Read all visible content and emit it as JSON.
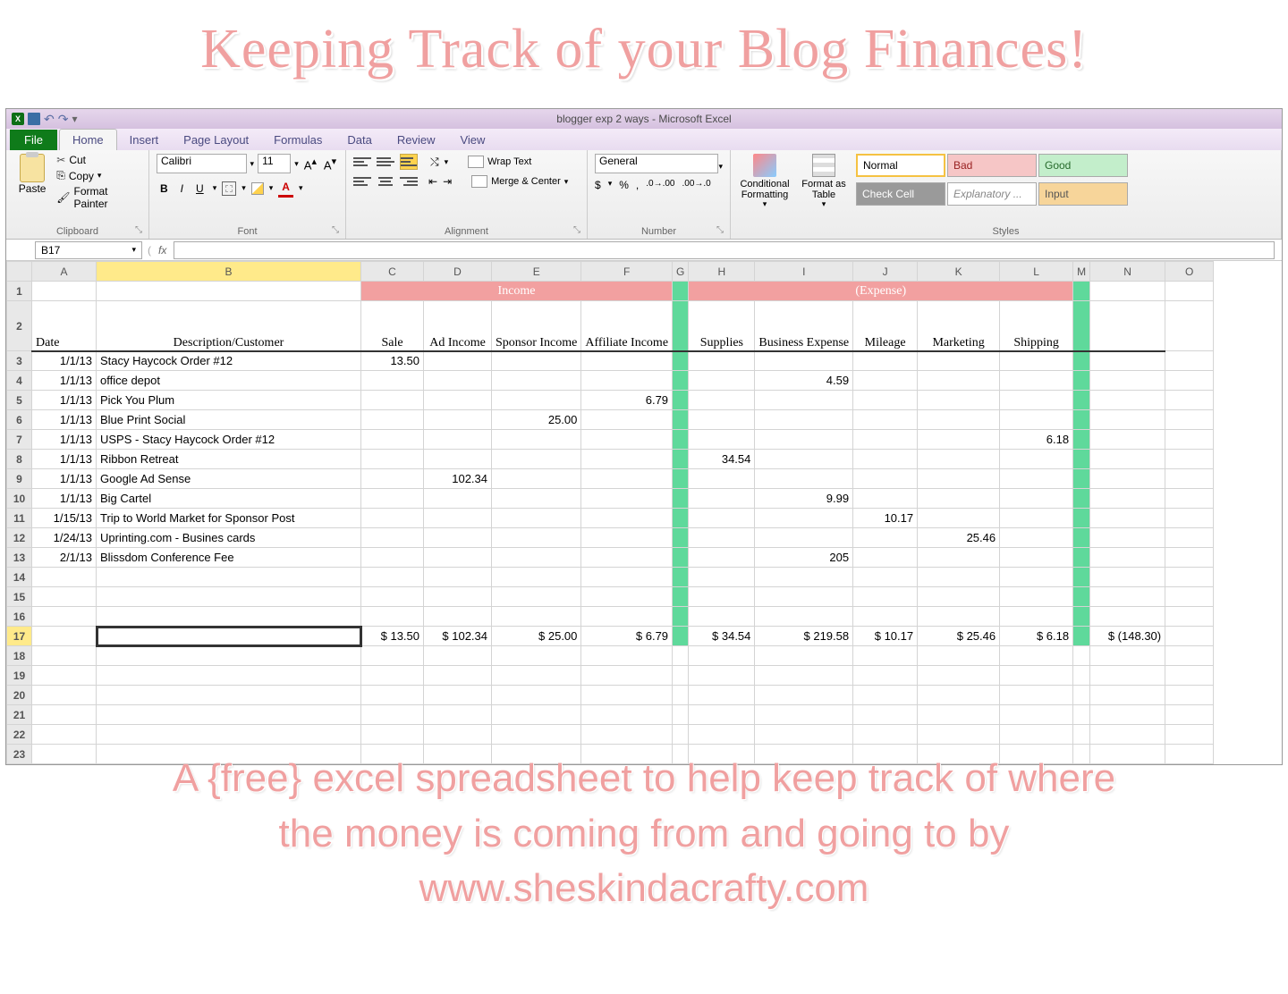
{
  "page_title": "Keeping Track of your Blog Finances!",
  "footer_line1": "A {free} excel spreadsheet to help keep track of where",
  "footer_line2": "the money is coming from and going to by",
  "footer_line3": "www.sheskindacrafty.com",
  "window_title": "blogger exp 2 ways - Microsoft Excel",
  "tabs": {
    "file": "File",
    "home": "Home",
    "insert": "Insert",
    "page_layout": "Page Layout",
    "formulas": "Formulas",
    "data": "Data",
    "review": "Review",
    "view": "View"
  },
  "clipboard": {
    "paste": "Paste",
    "cut": "Cut",
    "copy": "Copy",
    "painter": "Format Painter",
    "label": "Clipboard"
  },
  "font": {
    "name": "Calibri",
    "size": "11",
    "label": "Font"
  },
  "alignment": {
    "wrap": "Wrap Text",
    "merge": "Merge & Center",
    "label": "Alignment"
  },
  "number": {
    "format": "General",
    "label": "Number"
  },
  "styles": {
    "cond": "Conditional Formatting",
    "table": "Format as Table",
    "normal": "Normal",
    "bad": "Bad",
    "good": "Good",
    "check": "Check Cell",
    "expl": "Explanatory ...",
    "input": "Input",
    "label": "Styles"
  },
  "namebox": "B17",
  "fx": "fx",
  "columns": [
    "A",
    "B",
    "C",
    "D",
    "E",
    "F",
    "G",
    "H",
    "I",
    "J",
    "K",
    "L",
    "M",
    "N",
    "O"
  ],
  "section_income": "Income",
  "section_expense": "(Expense)",
  "headers": {
    "date": "Date",
    "desc": "Description/Customer",
    "sale": "Sale",
    "ad": "Ad Income",
    "sponsor": "Sponsor Income",
    "affiliate": "Affiliate Income",
    "supplies": "Supplies",
    "bexp": "Business Expense",
    "mileage": "Mileage",
    "marketing": "Marketing",
    "shipping": "Shipping"
  },
  "rows": [
    {
      "n": "3",
      "date": "1/1/13",
      "desc": "Stacy Haycock Order #12",
      "sale": "13.50"
    },
    {
      "n": "4",
      "date": "1/1/13",
      "desc": "office depot",
      "bexp": "4.59"
    },
    {
      "n": "5",
      "date": "1/1/13",
      "desc": "Pick You Plum",
      "affiliate": "6.79"
    },
    {
      "n": "6",
      "date": "1/1/13",
      "desc": "Blue Print Social",
      "sponsor": "25.00"
    },
    {
      "n": "7",
      "date": "1/1/13",
      "desc": "USPS - Stacy Haycock Order #12",
      "shipping": "6.18"
    },
    {
      "n": "8",
      "date": "1/1/13",
      "desc": "Ribbon Retreat",
      "supplies": "34.54"
    },
    {
      "n": "9",
      "date": "1/1/13",
      "desc": "Google Ad Sense",
      "ad": "102.34"
    },
    {
      "n": "10",
      "date": "1/1/13",
      "desc": "Big Cartel",
      "bexp": "9.99"
    },
    {
      "n": "11",
      "date": "1/15/13",
      "desc": "Trip to World Market for Sponsor Post",
      "mileage": "10.17"
    },
    {
      "n": "12",
      "date": "1/24/13",
      "desc": "Uprinting.com - Busines cards",
      "marketing": "25.46"
    },
    {
      "n": "13",
      "date": "2/1/13",
      "desc": "Blissdom Conference Fee",
      "bexp": "205"
    }
  ],
  "empty_rows": [
    "14",
    "15",
    "16"
  ],
  "totals": {
    "n": "17",
    "sale": "$    13.50",
    "ad": "$   102.34",
    "sponsor": "$     25.00",
    "affiliate": "$       6.79",
    "supplies": "$     34.54",
    "bexp": "$   219.58",
    "mileage": "$     10.17",
    "marketing": "$     25.46",
    "shipping": "$       6.18",
    "net": "$  (148.30)"
  },
  "trailing_rows": [
    "18",
    "19",
    "20",
    "21",
    "22",
    "23"
  ],
  "colwidths": {
    "A": 72,
    "B": 296,
    "C": 70,
    "D": 76,
    "E": 84,
    "F": 74,
    "G": 10,
    "H": 74,
    "I": 86,
    "J": 72,
    "K": 92,
    "L": 82,
    "M": 10,
    "N": 84,
    "O": 54
  }
}
